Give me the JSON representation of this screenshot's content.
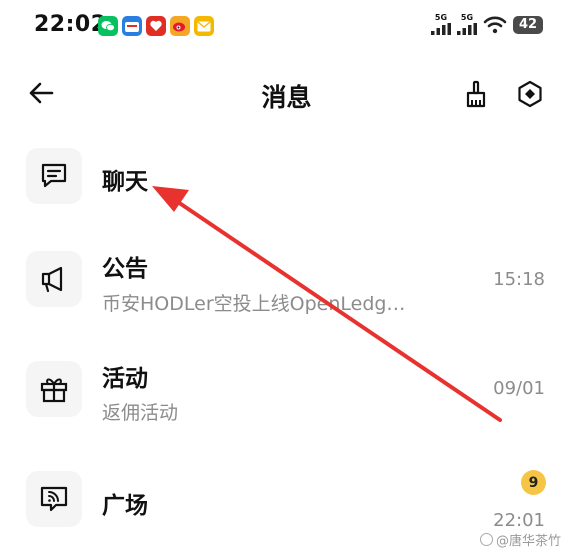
{
  "status_bar": {
    "time": "22:02",
    "notification_icons": [
      {
        "name": "wechat-icon",
        "color": "#07c160"
      },
      {
        "name": "taobao-app-icon",
        "color": "#2a7de1"
      },
      {
        "name": "pinduoduo-icon",
        "color": "#e02e24"
      },
      {
        "name": "weibo-icon",
        "color": "#e6162d"
      },
      {
        "name": "mail-app-icon",
        "color": "#f5b800"
      }
    ],
    "signal_1_label": "5G",
    "signal_2_label": "5G",
    "battery": "42"
  },
  "header": {
    "title": "消息"
  },
  "items": [
    {
      "title": "聊天",
      "icon": "chat-icon"
    },
    {
      "title": "公告",
      "subtitle": "币安HODLer空投上线OpenLedg…",
      "time": "15:18",
      "icon": "megaphone-icon"
    },
    {
      "title": "活动",
      "subtitle": "返佣活动",
      "time": "09/01",
      "icon": "gift-icon"
    },
    {
      "title": "广场",
      "time": "22:01",
      "badge": "9",
      "icon": "square-feed-icon"
    }
  ],
  "watermark": "@唐华茶竹",
  "colors": {
    "annotation_arrow": "#e8322e",
    "badge": "#f6c545",
    "icon_bg": "#f5f5f5"
  }
}
